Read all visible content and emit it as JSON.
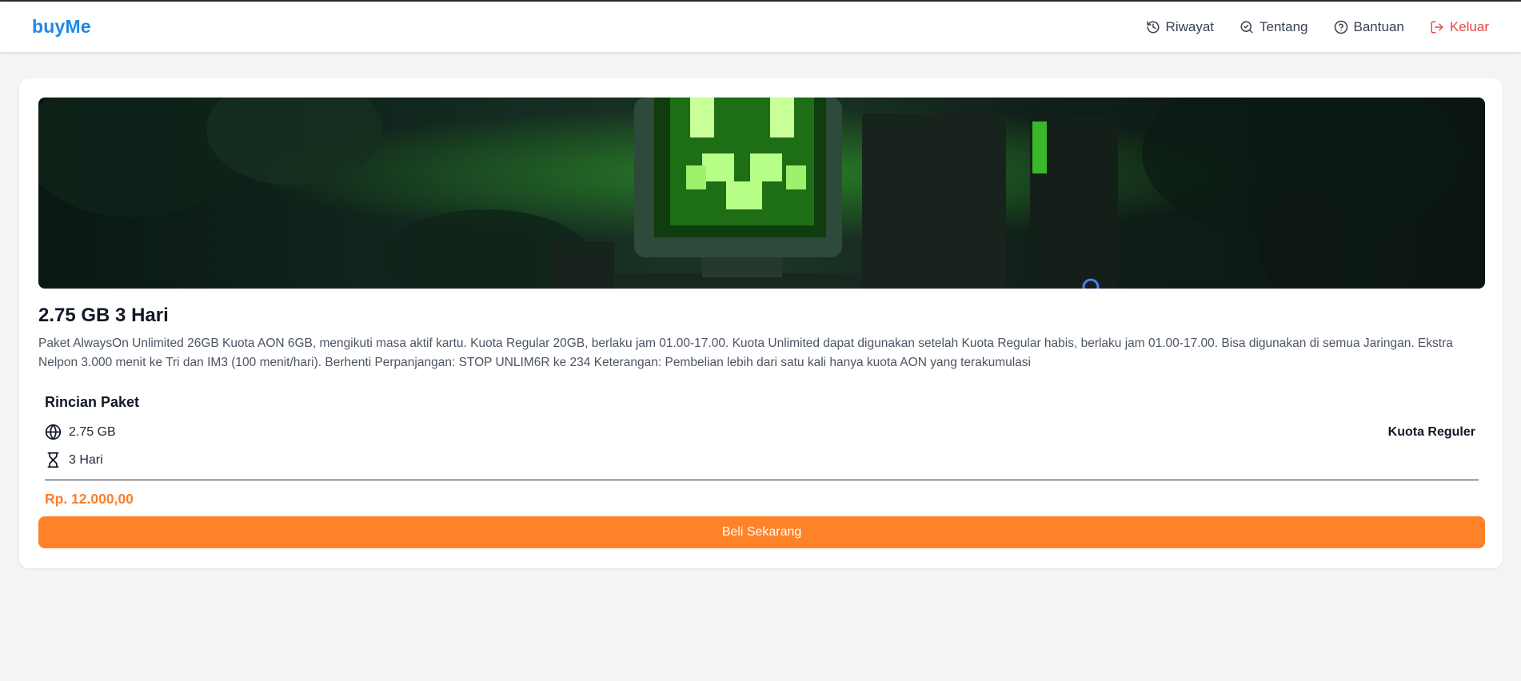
{
  "brand": "buyMe",
  "nav": [
    {
      "label": "Riwayat",
      "icon": "history-icon"
    },
    {
      "label": "Tentang",
      "icon": "search-check-icon"
    },
    {
      "label": "Bantuan",
      "icon": "help-circle-icon"
    },
    {
      "label": "Keluar",
      "icon": "logout-icon"
    }
  ],
  "colors": {
    "brand": "#1e88e5",
    "logout": "#ef4444",
    "accent": "#fd8228",
    "price": "#f97f2a"
  },
  "product": {
    "title": "2.75 GB 3 Hari",
    "description": "Paket AlwaysOn Unlimited 26GB Kuota AON 6GB, mengikuti masa aktif kartu. Kuota Regular 20GB, berlaku jam 01.00-17.00. Kuota Unlimited dapat digunakan setelah Kuota Regular habis, berlaku jam 01.00-17.00. Bisa digunakan di semua Jaringan. Ekstra Nelpon 3.000 menit ke Tri dan IM3 (100 menit/hari). Berhenti Perpanjangan: STOP UNLIM6R ke 234 Keterangan: Pembelian lebih dari satu kali hanya kuota AON yang terakumulasi",
    "details_title": "Rincian Paket",
    "quota": "2.75 GB",
    "duration": "3 Hari",
    "quota_type": "Kuota Reguler",
    "price": "Rp. 12.000,00",
    "buy_label": "Beli Sekarang"
  }
}
